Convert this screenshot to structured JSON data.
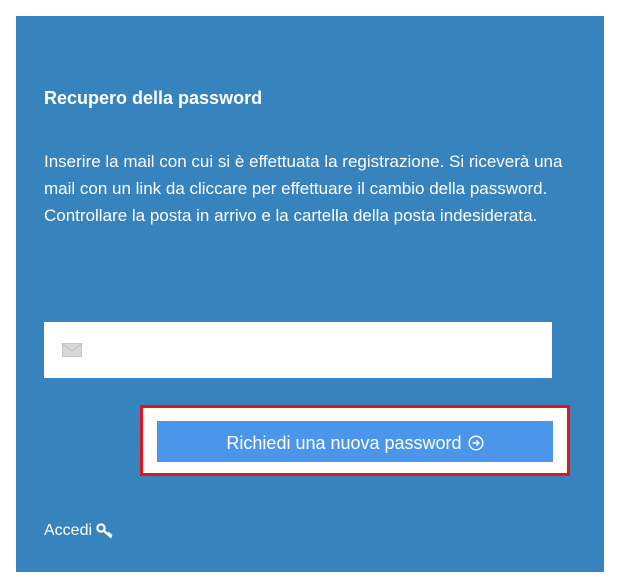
{
  "panel": {
    "title": "Recupero della password",
    "description": "Inserire la mail con cui si è effettuata la registrazione. Si riceverà una mail con un link da cliccare per effettuare il cambio della password. Controllare la posta in arrivo e la cartella della posta indesiderata.",
    "email_field": {
      "value": "",
      "placeholder": "",
      "icon": "envelope-icon"
    },
    "submit_button": {
      "label": "Richiedi una nuova password",
      "icon": "arrow-right-circle-icon"
    },
    "login_link": {
      "label": "Accedi",
      "icon": "key-icon"
    }
  },
  "colors": {
    "panel_background": "#3683be",
    "button_background": "#4b95ea",
    "highlight_border": "#e1141b",
    "text": "#ffffff"
  }
}
